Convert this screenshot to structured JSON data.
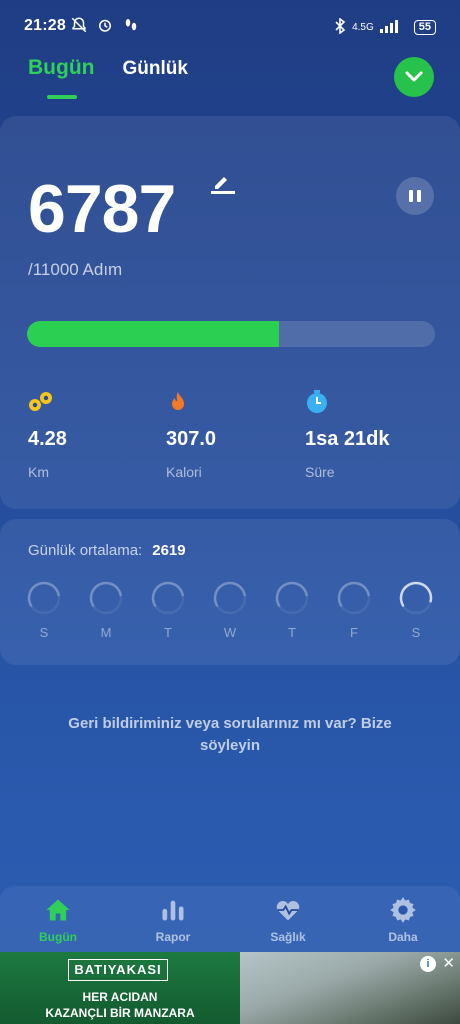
{
  "status_bar": {
    "time": "21:28",
    "network": "4.5G",
    "battery": "55"
  },
  "tabs": [
    {
      "label": "Bugün",
      "active": true
    },
    {
      "label": "Günlük",
      "active": false
    }
  ],
  "today": {
    "steps": "6787",
    "goal": "/11000 Adım",
    "progress_fraction": 0.617,
    "stats": [
      {
        "icon": "distance-icon",
        "value": "4.28",
        "label": "Km",
        "color": "#f5c518"
      },
      {
        "icon": "flame-icon",
        "value": "307.0",
        "label": "Kalori",
        "color": "#f07a2a"
      },
      {
        "icon": "timer-icon",
        "value": "1sa 21dk",
        "label": "Süre",
        "color": "#3ab0f2"
      }
    ]
  },
  "weekly": {
    "label": "Günlük ortalama:",
    "value": "2619",
    "days": [
      {
        "label": "S",
        "fraction": 0.0
      },
      {
        "label": "M",
        "fraction": 0.0
      },
      {
        "label": "T",
        "fraction": 0.0
      },
      {
        "label": "W",
        "fraction": 0.0
      },
      {
        "label": "T",
        "fraction": 0.0
      },
      {
        "label": "F",
        "fraction": 0.0
      },
      {
        "label": "S",
        "fraction": 0.617
      }
    ]
  },
  "feedback": "Geri bildiriminiz veya sorularınız mı var? Bize söyleyin",
  "nav": [
    {
      "label": "Bugün",
      "icon": "home-icon",
      "active": true
    },
    {
      "label": "Rapor",
      "icon": "bar-chart-icon",
      "active": false
    },
    {
      "label": "Sağlık",
      "icon": "heart-pulse-icon",
      "active": false
    },
    {
      "label": "Daha",
      "icon": "gear-icon",
      "active": false
    }
  ],
  "ad": {
    "brand": "BATIYAKASI",
    "line1": "HER ACIDAN",
    "line2": "KAZANÇLI BİR MANZARA"
  },
  "colors": {
    "accent": "#2fcf5a",
    "background": "#244a99"
  }
}
